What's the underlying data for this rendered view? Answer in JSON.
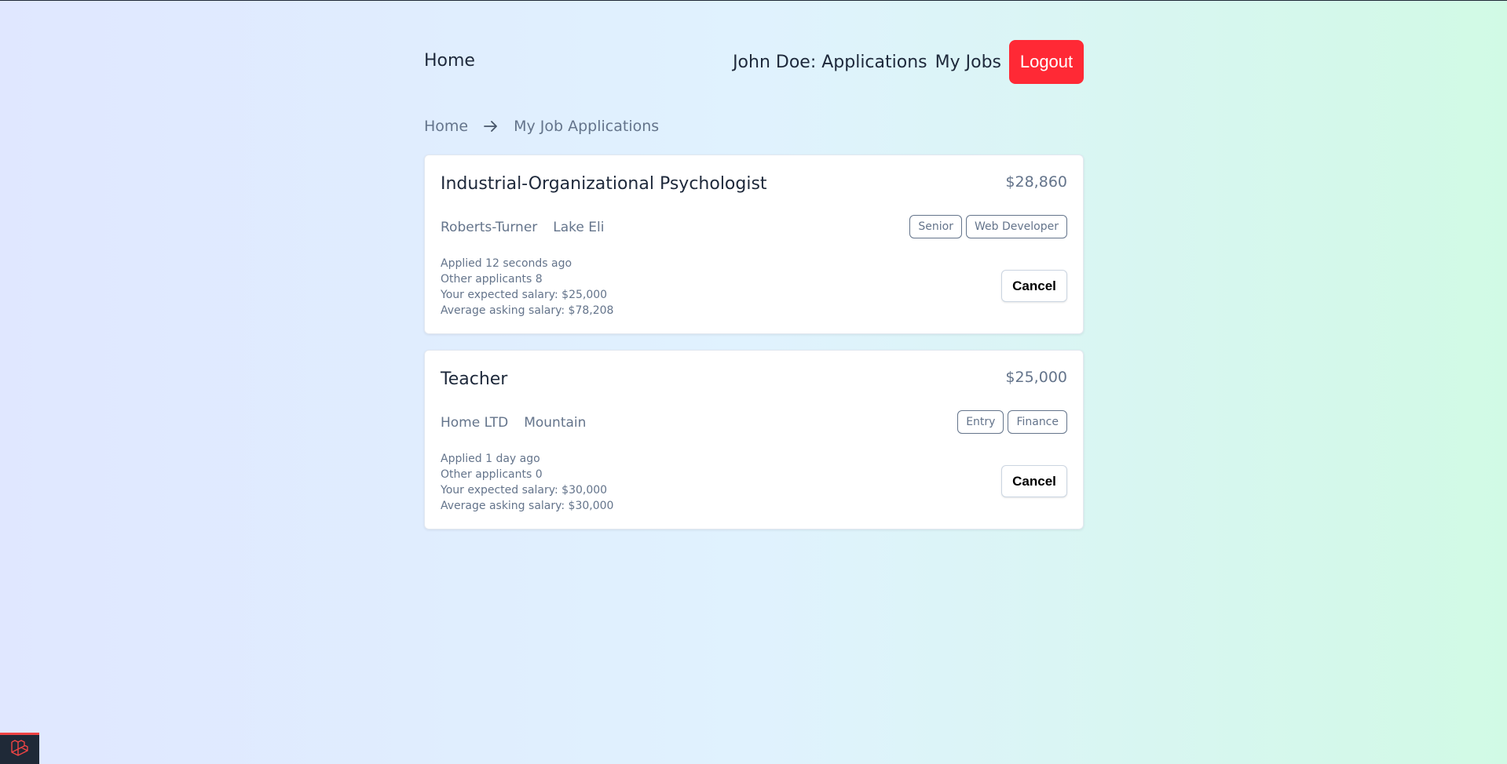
{
  "nav": {
    "home": "Home",
    "applications": "John Doe: Applications",
    "my_jobs": "My Jobs",
    "logout": "Logout"
  },
  "breadcrumb": {
    "home": "Home",
    "current": "My Job Applications"
  },
  "applications": [
    {
      "title": "Industrial-Organizational Psychologist",
      "salary": "$28,860",
      "company": "Roberts-Turner",
      "location": "Lake Eli",
      "tags": [
        "Senior",
        "Web Developer"
      ],
      "applied": "Applied 12 seconds ago",
      "other_applicants": "Other applicants 8",
      "expected_salary": "Your expected salary: $25,000",
      "average_salary": "Average asking salary: $78,208",
      "cancel": "Cancel"
    },
    {
      "title": "Teacher",
      "salary": "$25,000",
      "company": "Home LTD",
      "location": "Mountain",
      "tags": [
        "Entry",
        "Finance"
      ],
      "applied": "Applied 1 day ago",
      "other_applicants": "Other applicants 0",
      "expected_salary": "Your expected salary: $30,000",
      "average_salary": "Average asking salary: $30,000",
      "cancel": "Cancel"
    }
  ],
  "colors": {
    "logout_bg": "#ff2935",
    "text_dark": "#1e293b",
    "text_muted": "#64748b"
  },
  "icons": {
    "breadcrumb_separator": "arrow-right-icon",
    "debug_badge": "laravel-icon"
  }
}
